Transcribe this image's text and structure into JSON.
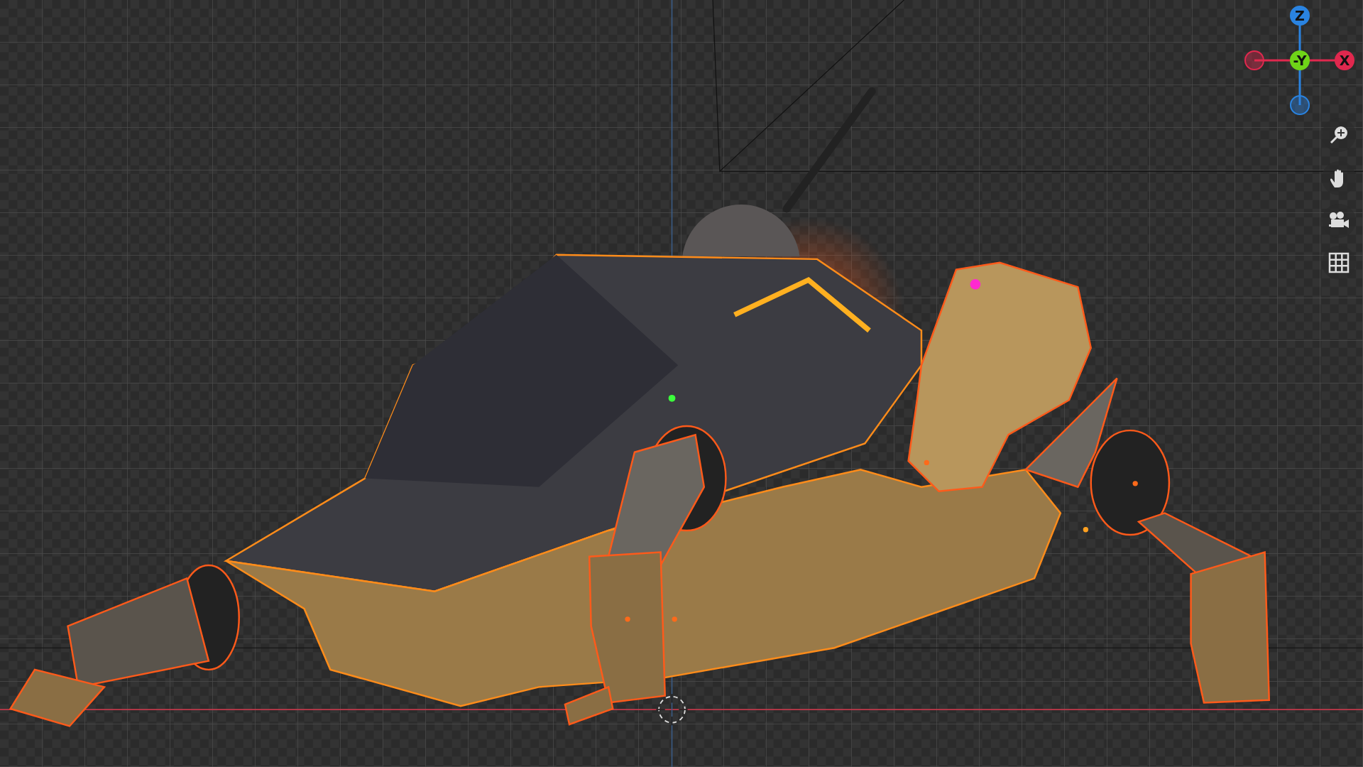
{
  "viewport": {
    "gizmo": {
      "axes": [
        {
          "kind": "up",
          "label": "Z",
          "color": "#2a83e0"
        },
        {
          "kind": "left",
          "color": "#e0284e"
        },
        {
          "kind": "center",
          "label": "-Y",
          "color": "#6fd418"
        },
        {
          "kind": "right",
          "label": "X",
          "color": "#e0284e"
        },
        {
          "kind": "down",
          "color": "#2a83e0"
        }
      ]
    }
  }
}
